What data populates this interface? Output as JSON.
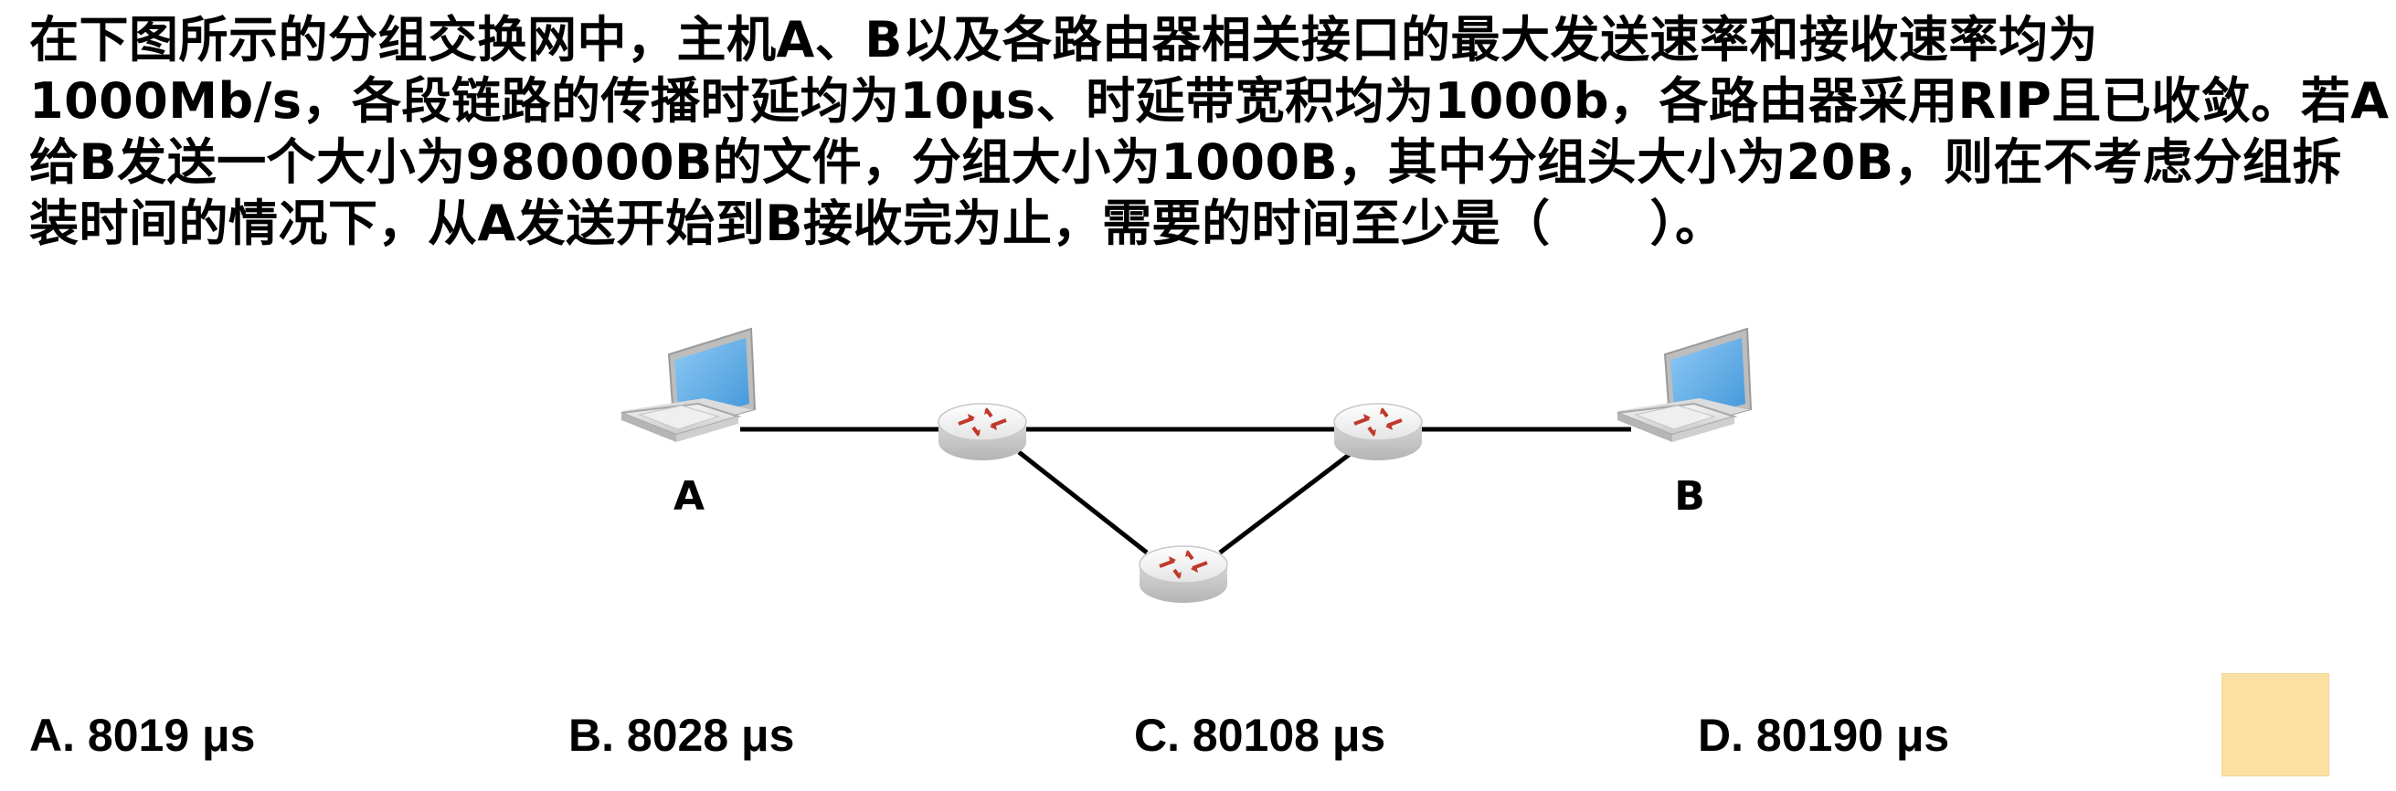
{
  "question": {
    "lines": [
      "在下图所示的分组交换网中，主机A、B以及各路由器相关接口的最大发送速率和接收速率均为",
      "1000Mb/s，各段链路的传播时延均为10μs、时延带宽积均为1000b，各路由器采用RIP且已收敛。若A",
      "给B发送一个大小为980000B的文件，分组大小为1000B，其中分组头大小为20B，则在不考虑分组拆",
      "装时间的情况下，从A发送开始到B接收完为止，需要的时间至少是（　　）。"
    ]
  },
  "diagram": {
    "hosts": [
      {
        "label": "A",
        "icon": "laptop-icon"
      },
      {
        "label": "B",
        "icon": "laptop-icon"
      }
    ],
    "routers": [
      {
        "icon": "router-icon"
      },
      {
        "icon": "router-icon"
      },
      {
        "icon": "router-icon"
      }
    ],
    "link_color": "#000000",
    "router_arrow_color": "#c0392b",
    "laptop_screen_color": "#5aaae8"
  },
  "options": [
    {
      "letter": "A.",
      "text": "8019 μs"
    },
    {
      "letter": "B.",
      "text": "8028 μs"
    },
    {
      "letter": "C.",
      "text": "80108 μs"
    },
    {
      "letter": "D.",
      "text": "80190 μs"
    }
  ],
  "answer_box": {
    "color": "#fbe0a4"
  }
}
